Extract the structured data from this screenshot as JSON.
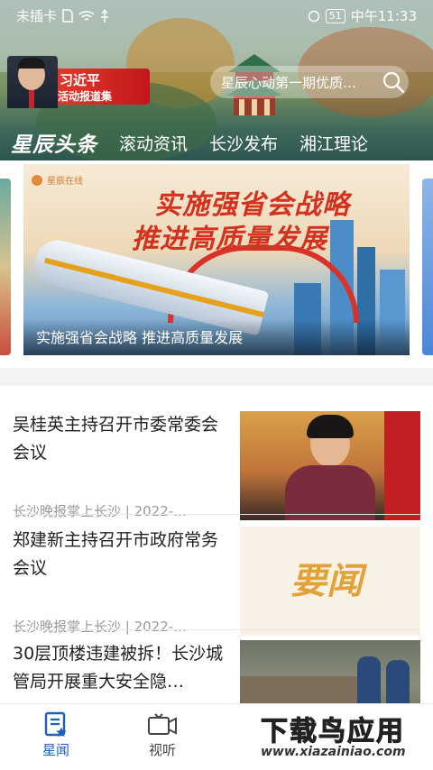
{
  "status_bar": {
    "carrier": "未插卡",
    "time": "中午11:33",
    "battery": "51"
  },
  "header": {
    "feature_badge": {
      "name": "习近平",
      "subtitle": "活动报道集"
    },
    "search": {
      "placeholder": "星辰心动第一期优质…"
    },
    "tabs": [
      {
        "label": "星辰头条",
        "active": true
      },
      {
        "label": "滚动资讯",
        "active": false
      },
      {
        "label": "长沙发布",
        "active": false
      },
      {
        "label": "湘江理论",
        "active": false
      }
    ]
  },
  "carousel": {
    "brand": "星辰在线",
    "headline_line1": "实施强省会战略",
    "headline_line2": "推进高质量发展",
    "caption": "实施强省会战略 推进高质量发展"
  },
  "news": [
    {
      "title": "吴桂英主持召开市委常委会会议",
      "meta": "长沙晚报掌上长沙 | 2022-…"
    },
    {
      "title": "郑建新主持召开市政府常务会议",
      "meta": "长沙晚报掌上长沙 | 2022-…",
      "thumb_text": "要闻"
    },
    {
      "title": "30层顶楼违建被拆！长沙城管局开展重大安全隐…",
      "meta": ""
    }
  ],
  "bottom_nav": [
    {
      "label": "星闻",
      "active": true
    },
    {
      "label": "视听",
      "active": false
    },
    {
      "label": "",
      "active": false
    },
    {
      "label": "",
      "active": false
    },
    {
      "label": "",
      "active": false
    }
  ],
  "watermark": {
    "line1": "下载鸟应用",
    "line2": "www.xiazainiao.com"
  },
  "colors": {
    "accent": "#1f5fb8",
    "headline_red": "#d3321f"
  }
}
